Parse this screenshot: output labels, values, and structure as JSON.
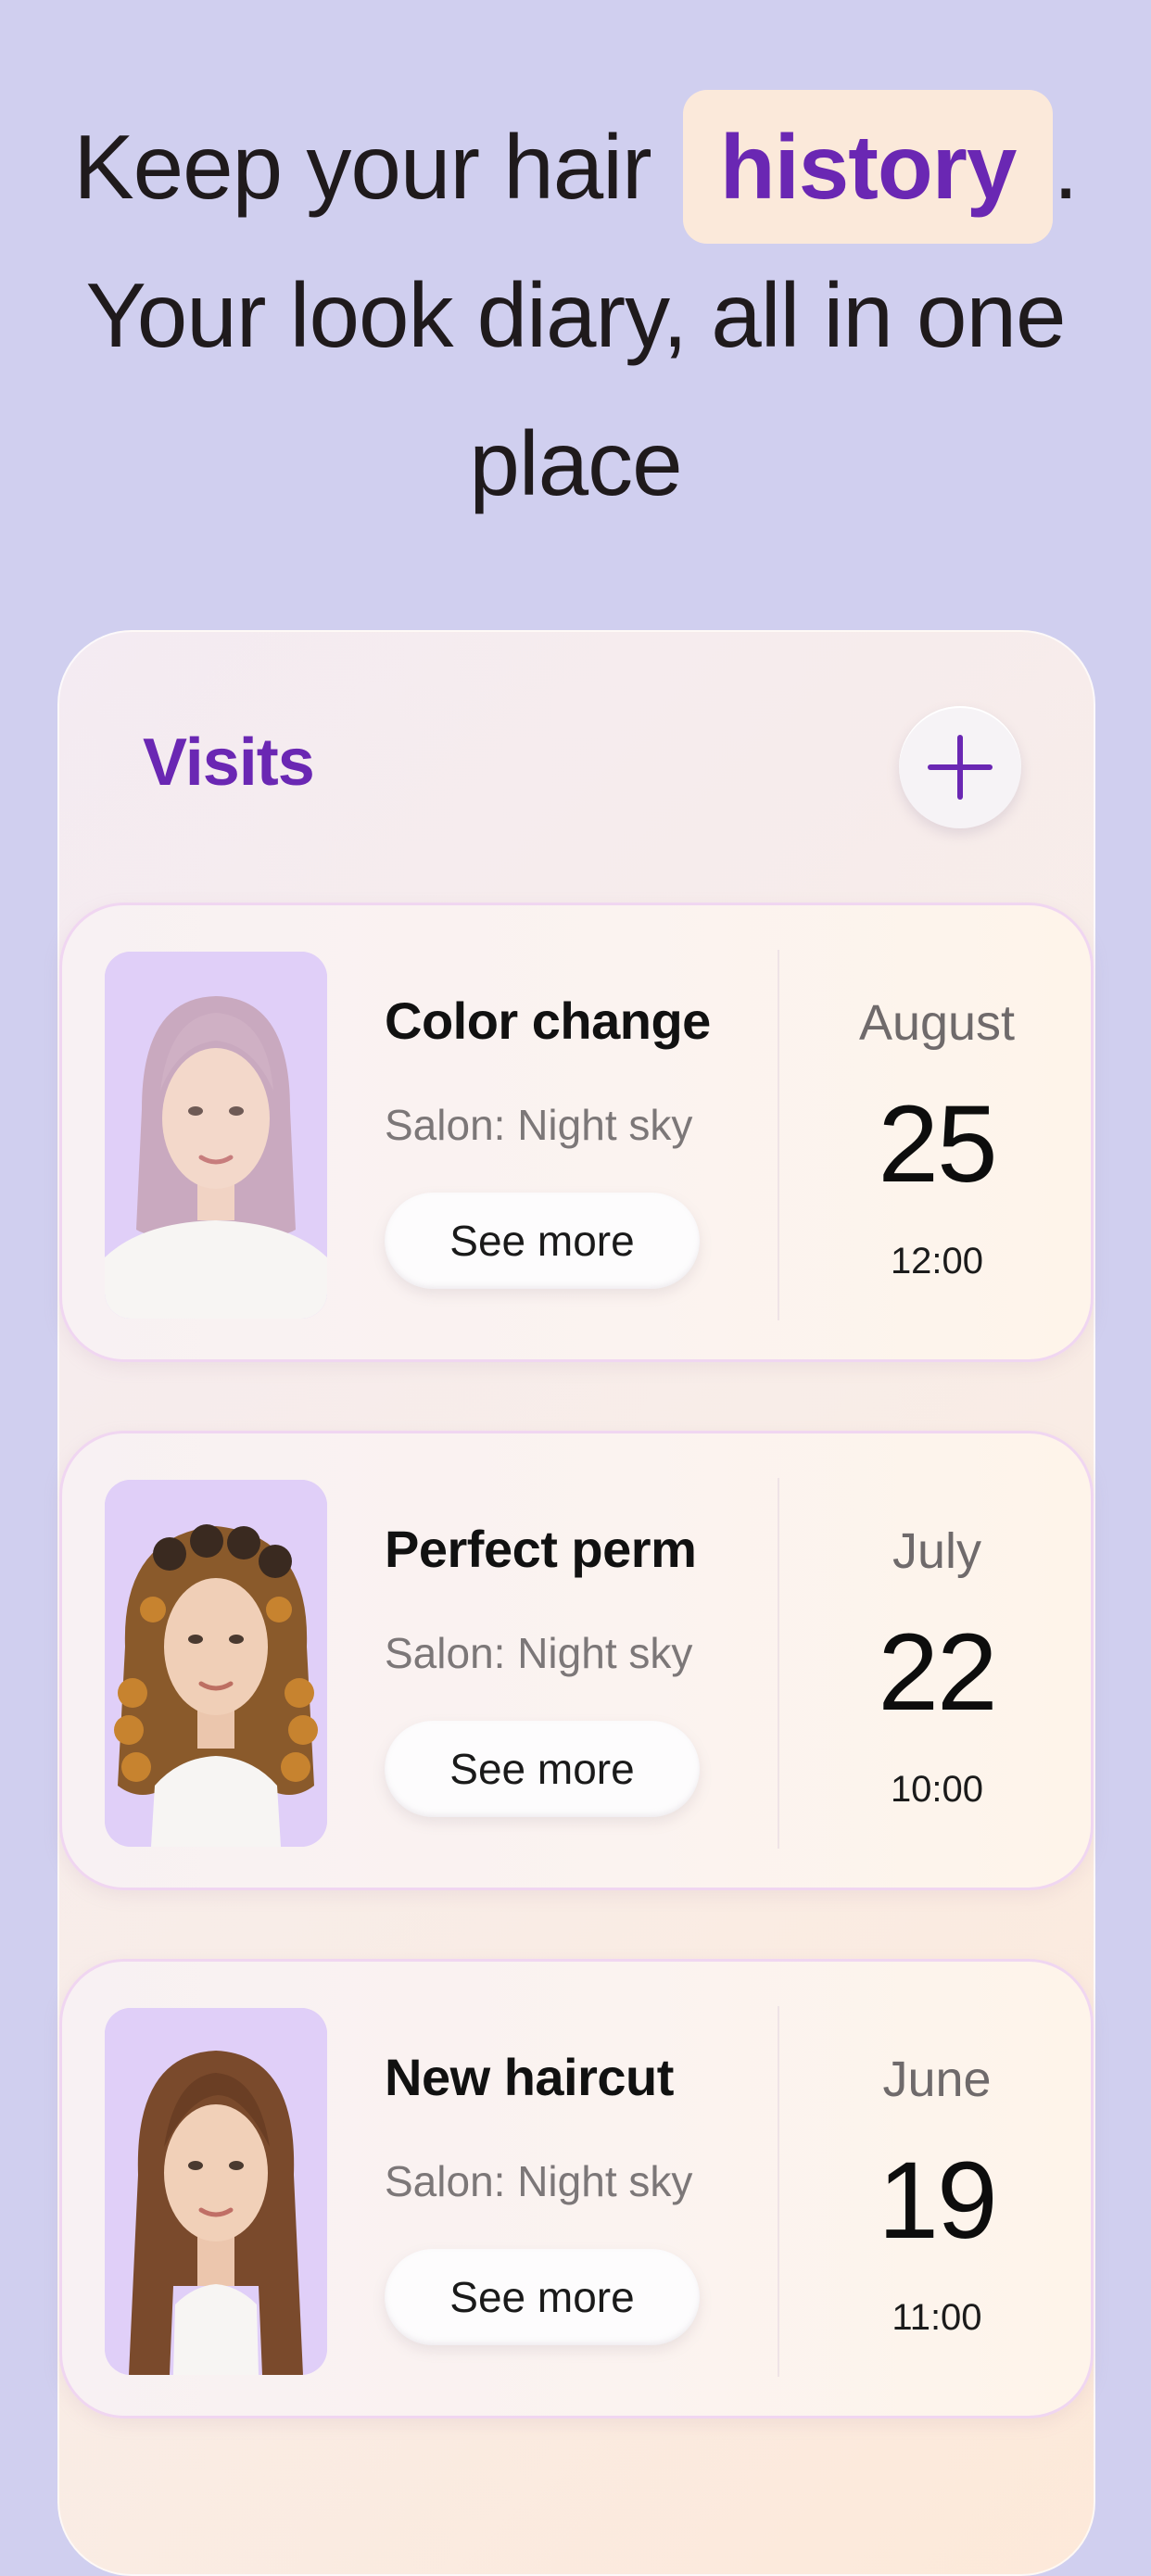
{
  "hero": {
    "line1_text": "Keep your hair",
    "highlight_word": "history",
    "line1_end": ".",
    "line2": "Your look diary, all in one",
    "line3": "place"
  },
  "visits_panel": {
    "title": "Visits",
    "add_icon": "plus-icon",
    "items": [
      {
        "title": "Color change",
        "salon": "Salon: Night sky",
        "button": "See more",
        "month": "August",
        "day": "25",
        "time": "12:00",
        "photo": "pink-bob-portrait"
      },
      {
        "title": "Perfect perm",
        "salon": "Salon: Night sky",
        "button": "See more",
        "month": "July",
        "day": "22",
        "time": "10:00",
        "photo": "curly-hair-portrait"
      },
      {
        "title": "New haircut",
        "salon": "Salon: Night sky",
        "button": "See more",
        "month": "June",
        "day": "19",
        "time": "11:00",
        "photo": "long-brown-hair-portrait"
      }
    ]
  },
  "colors": {
    "background": "#d0cfef",
    "accent": "#6a27b3",
    "highlight_chip": "#fbe9da"
  }
}
